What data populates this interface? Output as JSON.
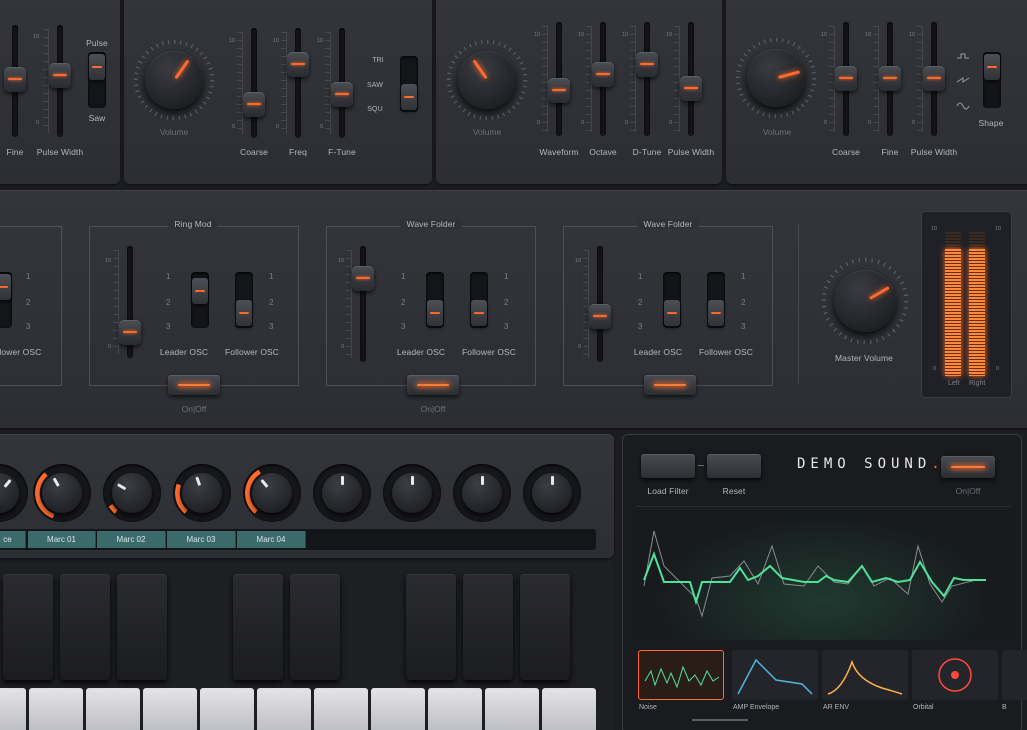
{
  "osc_row": {
    "osc_a": {
      "labels": [
        "Fine",
        "Pulse Width"
      ],
      "switch_labels": [
        "Pulse",
        "Saw"
      ],
      "scale": [
        "10",
        "0"
      ]
    },
    "osc_b": {
      "knob_label": "Volume",
      "labels": [
        "Coarse",
        "Freq",
        "F-Tune"
      ],
      "switch_labels": [
        "TRI",
        "SAW",
        "SQU"
      ],
      "scale": [
        "10",
        "0"
      ]
    },
    "osc_c": {
      "knob_label": "Volume",
      "labels": [
        "Waveform",
        "Octave",
        "D-Tune",
        "Pulse Width"
      ],
      "scale": [
        "10",
        "0"
      ]
    },
    "osc_d": {
      "knob_label": "Volume",
      "labels": [
        "Coarse",
        "Fine",
        "Pulse Width"
      ],
      "shape_label": "Shape",
      "scale": [
        "10",
        "0"
      ]
    }
  },
  "mod_row": {
    "partial": {
      "label": "ollower OSC",
      "nums": [
        "1",
        "2",
        "3"
      ]
    },
    "ring_mod": {
      "title": "Ring Mod",
      "labels": [
        "Leader OSC",
        "Follower OSC"
      ],
      "onoff": "On|Off",
      "nums": [
        "1",
        "2",
        "3"
      ],
      "scale": [
        "10",
        "0"
      ]
    },
    "wave_folder_1": {
      "title": "Wave Folder",
      "labels": [
        "Leader OSC",
        "Follower OSC"
      ],
      "onoff": "On|Off",
      "nums": [
        "1",
        "2",
        "3"
      ],
      "scale": [
        "10",
        "0"
      ]
    },
    "wave_folder_2": {
      "title": "Wave Folder",
      "labels": [
        "Leader OSC",
        "Follower OSC"
      ],
      "onoff": "On|Off",
      "nums": [
        "1",
        "2",
        "3"
      ],
      "scale": [
        "10",
        "0"
      ]
    },
    "master": {
      "label": "Master Volume"
    },
    "vu": {
      "scale_top": "10",
      "scale_bottom": "0",
      "left": "Left",
      "right": "Right",
      "left_level": 0.88,
      "right_level": 0.88
    }
  },
  "macro": {
    "tabs": [
      "ce",
      "Marc 01",
      "Marc 02",
      "Marc 03",
      "Marc 04"
    ],
    "accent": "#3a6a6a"
  },
  "demo": {
    "load_filter": "Load Filter",
    "reset": "Reset",
    "title": "DEMO SOUND",
    "title_dot": ".",
    "onoff": "On|Off",
    "wave_color": "#4ee39a",
    "thumbs": [
      "Noise",
      "AMP Envelope",
      "AR ENV",
      "Orbital",
      "B"
    ]
  },
  "colors": {
    "accent": "#ff6a2c",
    "panel": "#2f3136",
    "background": "#1c1d21"
  }
}
